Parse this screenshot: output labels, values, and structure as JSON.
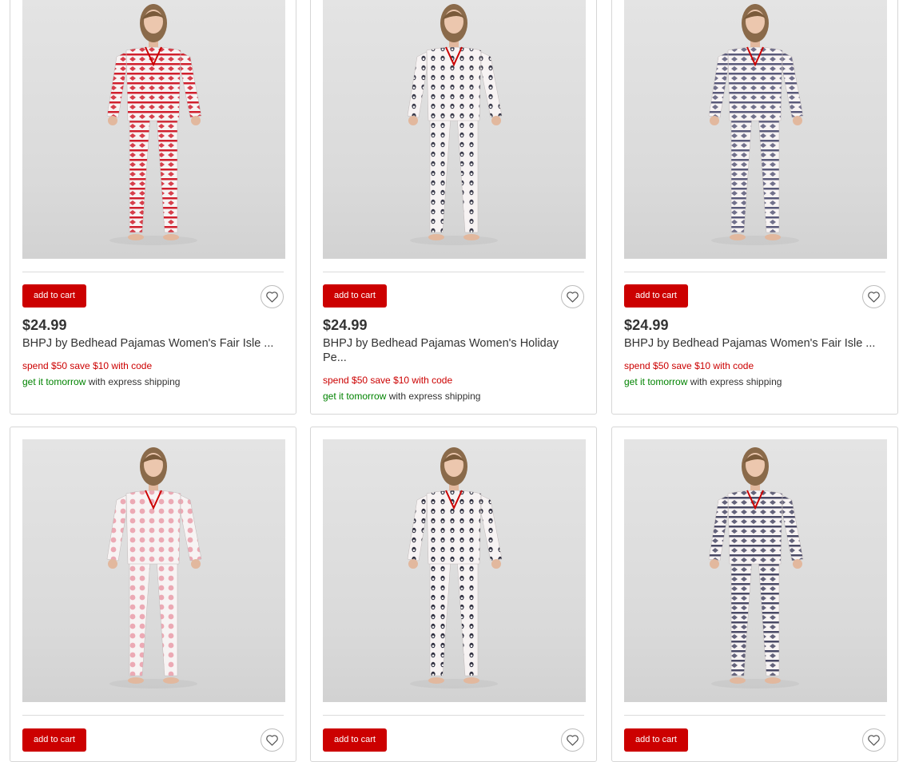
{
  "colors": {
    "brand_red": "#cc0000",
    "ship_green": "#008300",
    "text": "#333333",
    "border": "#d6d6d6"
  },
  "icons": {
    "favorite": "heart-outline-icon"
  },
  "products": [
    {
      "add_to_cart": "add to cart",
      "price": "$24.99",
      "title": "BHPJ by Bedhead Pajamas Women's Fair Isle ...",
      "promo": "spend $50 save $10 with code",
      "ship_fast": "get it tomorrow",
      "ship_rest": " with express shipping",
      "pajama_color": "#d0202e",
      "pattern": "fair-isle-red"
    },
    {
      "add_to_cart": "add to cart",
      "price": "$24.99",
      "title": "BHPJ by Bedhead Pajamas Women's Holiday Pe...",
      "promo": "spend $50 save $10 with code",
      "ship_fast": "get it tomorrow",
      "ship_rest": " with express shipping",
      "pajama_color": "#3a3a4a",
      "pattern": "penguin-print"
    },
    {
      "add_to_cart": "add to cart",
      "price": "$24.99",
      "title": "BHPJ by Bedhead Pajamas Women's Fair Isle ...",
      "promo": "spend $50 save $10 with code",
      "ship_fast": "get it tomorrow",
      "ship_rest": " with express shipping",
      "pajama_color": "#5a5a7a",
      "pattern": "fair-isle-navy"
    },
    {
      "add_to_cart": "add to cart",
      "pajama_color": "#e88a9a",
      "pattern": "snowflake-pink"
    },
    {
      "add_to_cart": "add to cart",
      "pajama_color": "#2e2e3e",
      "pattern": "penguin-print"
    },
    {
      "add_to_cart": "add to cart",
      "pajama_color": "#4a4a66",
      "pattern": "fair-isle-navy"
    }
  ]
}
